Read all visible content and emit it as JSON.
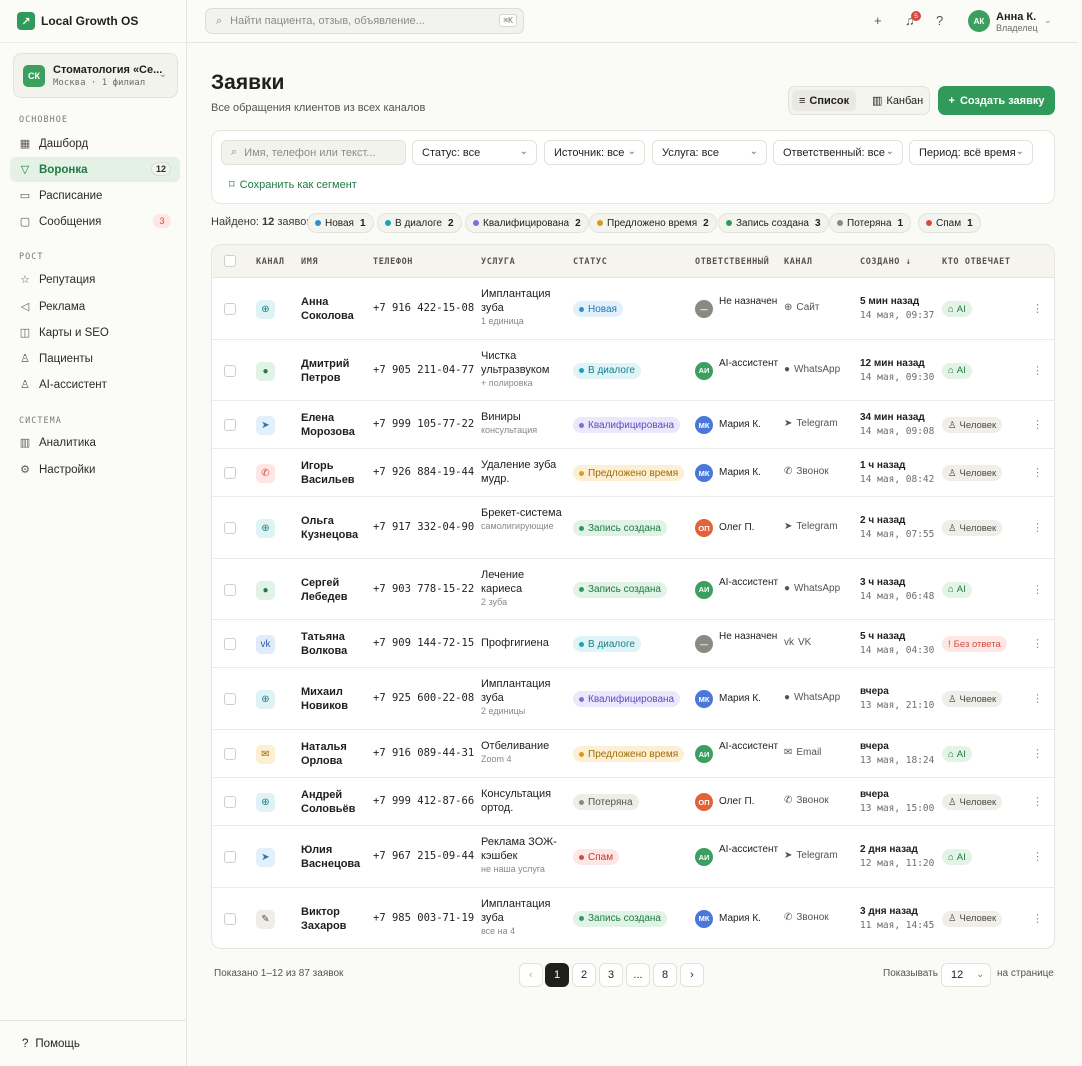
{
  "brand": {
    "name": "Local Growth OS"
  },
  "org": {
    "initials": "СК",
    "name": "Стоматология «Се...",
    "sub": "Москва · 1 филиал"
  },
  "sidebar": {
    "sections": [
      "ОСНОВНОЕ",
      "РОСТ",
      "СИСТЕМА"
    ],
    "items": [
      {
        "label": "Дашборд",
        "icon": "grid-icon"
      },
      {
        "label": "Воронка",
        "icon": "funnel-icon",
        "badge": "12",
        "active": true
      },
      {
        "label": "Расписание",
        "icon": "calendar-icon"
      },
      {
        "label": "Сообщения",
        "icon": "message-icon",
        "badge": "3"
      },
      {
        "label": "Репутация",
        "icon": "star-icon"
      },
      {
        "label": "Реклама",
        "icon": "megaphone-icon"
      },
      {
        "label": "Карты и SEO",
        "icon": "map-icon"
      },
      {
        "label": "Пациенты",
        "icon": "users-icon"
      },
      {
        "label": "AI-ассистент",
        "icon": "robot-icon"
      },
      {
        "label": "Аналитика",
        "icon": "bar-chart-icon"
      },
      {
        "label": "Настройки",
        "icon": "gear-icon"
      }
    ],
    "help": "Помощь"
  },
  "topbar": {
    "search_placeholder": "Найти пациента, отзыв, объявление...",
    "search_kbd": "⌘K",
    "notif_count": "5",
    "user": {
      "initials": "АК",
      "name": "Анна К.",
      "role": "Владелец"
    }
  },
  "page": {
    "title": "Заявки",
    "subtitle": "Все обращения клиентов из всех каналов",
    "view_list": "Список",
    "view_kanban": "Канбан",
    "create": "Создать заявку"
  },
  "filters": {
    "search_placeholder": "Имя, телефон или текст...",
    "selects": [
      "Статус: все",
      "Источник: все",
      "Услуга: все",
      "Ответственный: все",
      "Период: всё время"
    ],
    "save_segment": "Сохранить как сегмент"
  },
  "summary": {
    "found_prefix": "Найдено: ",
    "found_count": "12",
    "found_suffix": " заявок",
    "chips": [
      {
        "label": "Новая",
        "count": "1",
        "color": "#2b8fd6"
      },
      {
        "label": "В диалоге",
        "count": "2",
        "color": "#1aa3b5"
      },
      {
        "label": "Квалифицирована",
        "count": "2",
        "color": "#7b6fd8"
      },
      {
        "label": "Предложено время",
        "count": "2",
        "color": "#d99a1e"
      },
      {
        "label": "Запись создана",
        "count": "3",
        "color": "#2f9a5a"
      },
      {
        "label": "Потеряна",
        "count": "1",
        "color": "#8a8983"
      },
      {
        "label": "Спам",
        "count": "1",
        "color": "#d64b3f"
      }
    ]
  },
  "table": {
    "headers": [
      "КАНАЛ",
      "ИМЯ",
      "ТЕЛЕФОН",
      "УСЛУГА",
      "СТАТУС",
      "ОТВЕТСТВЕННЫЙ",
      "КАНАЛ",
      "СОЗДАНО ↓",
      "КТО ОТВЕЧАЕТ"
    ],
    "rows": [
      {
        "channel": "web",
        "name": "Анна Соколова",
        "phone": "+7 916 422-15-08",
        "service": "Имплантация зуба",
        "service_note": "1 единица",
        "status": "Новая",
        "resp_initials": "—",
        "resp": "Не назначен",
        "chan_label": "Сайт",
        "created": "5 мин назад",
        "created_at": "14 мая, 09:37",
        "who": "AI",
        "who_type": "ai"
      },
      {
        "channel": "whatsapp",
        "name": "Дмитрий Петров",
        "phone": "+7 905 211-04-77",
        "service": "Чистка ультразвуком",
        "service_note": "+ полировка",
        "status": "В диалоге",
        "resp_initials": "АИ",
        "resp": "AI-ассистент",
        "chan_label": "WhatsApp",
        "created": "12 мин назад",
        "created_at": "14 мая, 09:30",
        "who": "AI",
        "who_type": "ai"
      },
      {
        "channel": "telegram",
        "name": "Елена Морозова",
        "phone": "+7 999 105-77-22",
        "service": "Виниры",
        "service_note": "консультация",
        "status": "Квалифицирована",
        "resp_initials": "МК",
        "resp": "Мария К.",
        "chan_label": "Telegram",
        "created": "34 мин назад",
        "created_at": "14 мая, 09:08",
        "who": "Человек",
        "who_type": "human"
      },
      {
        "channel": "phone",
        "name": "Игорь Васильев",
        "phone": "+7 926 884-19-44",
        "service": "Удаление зуба мудр.",
        "service_note": "",
        "status": "Предложено время",
        "resp_initials": "МК",
        "resp": "Мария К.",
        "chan_label": "Звонок",
        "created": "1 ч назад",
        "created_at": "14 мая, 08:42",
        "who": "Человек",
        "who_type": "human"
      },
      {
        "channel": "web",
        "name": "Ольга Кузнецова",
        "phone": "+7 917 332-04-90",
        "service": "Брекет-система",
        "service_note": "самолигирующие",
        "status": "Запись создана",
        "resp_initials": "ОП",
        "resp": "Олег П.",
        "chan_label": "Telegram",
        "created": "2 ч назад",
        "created_at": "14 мая, 07:55",
        "who": "Человек",
        "who_type": "human"
      },
      {
        "channel": "whatsapp",
        "name": "Сергей Лебедев",
        "phone": "+7 903 778-15-22",
        "service": "Лечение кариеса",
        "service_note": "2 зуба",
        "status": "Запись создана",
        "resp_initials": "АИ",
        "resp": "AI-ассистент",
        "chan_label": "WhatsApp",
        "created": "3 ч назад",
        "created_at": "14 мая, 06:48",
        "who": "AI",
        "who_type": "ai"
      },
      {
        "channel": "vk",
        "name": "Татьяна Волкова",
        "phone": "+7 909 144-72-15",
        "service": "Профгигиена",
        "service_note": "",
        "status": "В диалоге",
        "resp_initials": "—",
        "resp": "Не назначен",
        "chan_label": "VK",
        "created": "5 ч назад",
        "created_at": "14 мая, 04:30",
        "who": "Без ответа",
        "who_type": "none"
      },
      {
        "channel": "web",
        "name": "Михаил Новиков",
        "phone": "+7 925 600-22-08",
        "service": "Имплантация зуба",
        "service_note": "2 единицы",
        "status": "Квалифицирована",
        "resp_initials": "МК",
        "resp": "Мария К.",
        "chan_label": "WhatsApp",
        "created": "вчера",
        "created_at": "13 мая, 21:10",
        "who": "Человек",
        "who_type": "human"
      },
      {
        "channel": "email",
        "name": "Наталья Орлова",
        "phone": "+7 916 089-44-31",
        "service": "Отбеливание",
        "service_note": "Zoom 4",
        "status": "Предложено время",
        "resp_initials": "АИ",
        "resp": "AI-ассистент",
        "chan_label": "Email",
        "created": "вчера",
        "created_at": "13 мая, 18:24",
        "who": "AI",
        "who_type": "ai"
      },
      {
        "channel": "web",
        "name": "Андрей Соловьёв",
        "phone": "+7 999 412-87-66",
        "service": "Консультация ортод.",
        "service_note": "",
        "status": "Потеряна",
        "resp_initials": "ОП",
        "resp": "Олег П.",
        "chan_label": "Звонок",
        "created": "вчера",
        "created_at": "13 мая, 15:00",
        "who": "Человек",
        "who_type": "human"
      },
      {
        "channel": "telegram",
        "name": "Юлия Васнецова",
        "phone": "+7 967 215-09-44",
        "service": "Реклама ЗОЖ-кэшбек",
        "service_note": "не наша услуга",
        "status": "Спам",
        "resp_initials": "АИ",
        "resp": "AI-ассистент",
        "chan_label": "Telegram",
        "created": "2 дня назад",
        "created_at": "12 мая, 11:20",
        "who": "AI",
        "who_type": "ai"
      },
      {
        "channel": "manual",
        "name": "Виктор Захаров",
        "phone": "+7 985 003-71-19",
        "service": "Имплантация зуба",
        "service_note": "все на 4",
        "status": "Запись создана",
        "resp_initials": "МК",
        "resp": "Мария К.",
        "chan_label": "Звонок",
        "created": "3 дня назад",
        "created_at": "11 мая, 14:45",
        "who": "Человек",
        "who_type": "human"
      }
    ]
  },
  "pagination": {
    "shown": "Показано 1–12 из 87 заявок",
    "pages": [
      "1",
      "2",
      "3",
      "...",
      "8"
    ],
    "prev": "‹",
    "next": "›",
    "per_page_label": "Показывать",
    "per_page": "12",
    "per_page_suffix": "на странице"
  },
  "colors": {
    "accent": "#2f9a5a",
    "status": {
      "Новая": [
        "#e1f0fb",
        "#1f77b4",
        "#2b8fd6"
      ],
      "В диалоге": [
        "#dff4f6",
        "#137f8d",
        "#1aa3b5"
      ],
      "Квалифицирована": [
        "#ebe8fb",
        "#5a4fc0",
        "#7b6fd8"
      ],
      "Предложено время": [
        "#fcefd3",
        "#a06a08",
        "#d99a1e"
      ],
      "Запись создана": [
        "#e1f3e6",
        "#1f7a43",
        "#2f9a5a"
      ],
      "Потеряна": [
        "#eeede8",
        "#55544e",
        "#8a8983"
      ],
      "Спам": [
        "#fde6e4",
        "#c2392d",
        "#d64b3f"
      ]
    }
  }
}
